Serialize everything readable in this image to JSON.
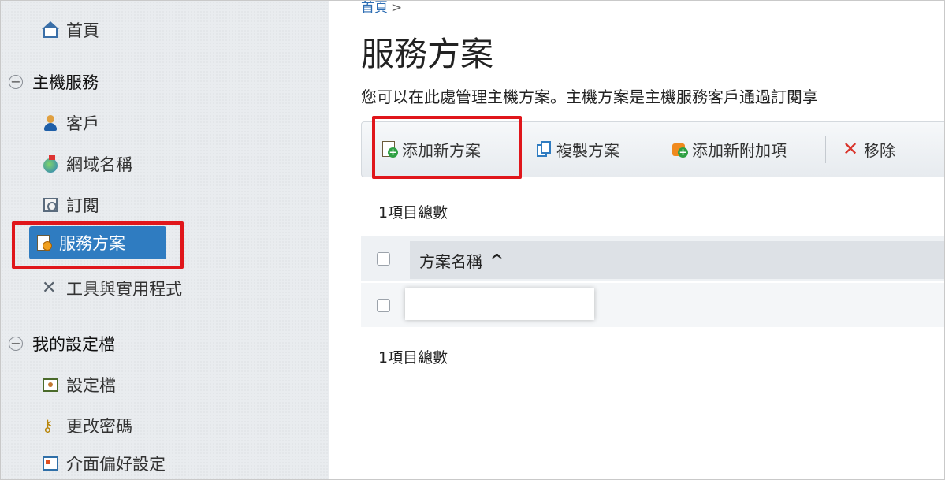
{
  "sidebar": {
    "home": "首頁",
    "sections": [
      {
        "label": "主機服務",
        "items": [
          "客戶",
          "網域名稱",
          "訂閱",
          "服務方案",
          "工具與實用程式"
        ]
      },
      {
        "label": "我的設定檔",
        "items": [
          "設定檔",
          "更改密碼",
          "介面偏好設定"
        ]
      }
    ],
    "active_item": "服務方案",
    "collapse_symbol": "−"
  },
  "breadcrumb": {
    "home": "首頁",
    "separator": ">"
  },
  "page": {
    "title": "服務方案",
    "description": "您可以在此處管理主機方案。主機方案是主機服務客戶通過訂閱享"
  },
  "toolbar": {
    "add_plan": "添加新方案",
    "copy_plan": "複製方案",
    "add_addon": "添加新附加項",
    "remove": "移除"
  },
  "list": {
    "count_top": "1項目總數",
    "count_bottom": "1項目總數",
    "column_header": "方案名稱",
    "sort_indicator": "^",
    "rows": [
      ""
    ]
  },
  "colors": {
    "accent": "#2f7cc1",
    "highlight": "#e0161b",
    "link": "#2d6db3"
  },
  "icons": {
    "home": "home-icon",
    "customers": "customer-icon",
    "domains": "globe-icon",
    "subscriptions": "subscription-icon",
    "service_plans": "service-plan-icon",
    "tools": "tools-icon",
    "profile": "profile-icon",
    "password": "key-icon",
    "preferences": "preferences-icon",
    "add_plan": "add-plan-icon",
    "copy_plan": "copy-icon",
    "add_addon": "addon-icon",
    "remove": "remove-icon"
  }
}
